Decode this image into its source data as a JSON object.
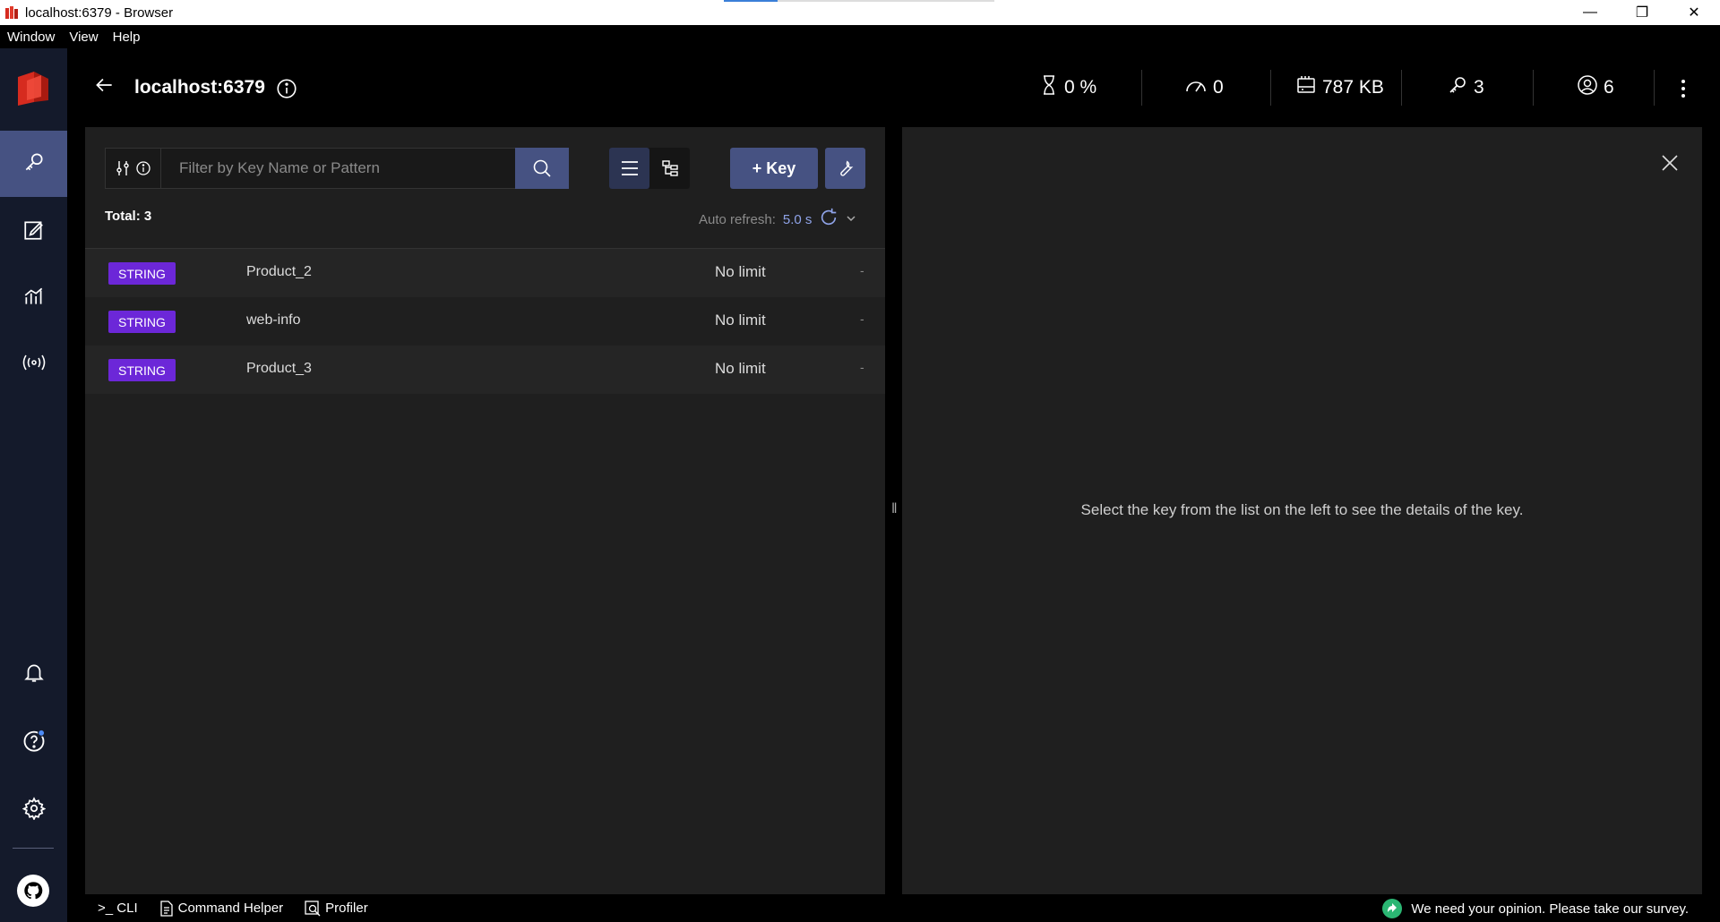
{
  "window": {
    "title": "localhost:6379 - Browser",
    "loading_progress": 0.2,
    "controls": [
      "—",
      "❐",
      "✕"
    ]
  },
  "menu": [
    "Window",
    "View",
    "Help"
  ],
  "header": {
    "host": "localhost:6379",
    "stats": {
      "cpu": "0 %",
      "ops": "0",
      "memory": "787 KB",
      "keys": "3",
      "clients": "6"
    }
  },
  "browser": {
    "search": {
      "placeholder": "Filter by Key Name or Pattern",
      "value": ""
    },
    "add_key_label": "+ Key",
    "total_label": "Total: 3",
    "auto_refresh_label": "Auto refresh:",
    "auto_refresh_value": "5.0 s",
    "keys": [
      {
        "type": "STRING",
        "name": "Product_2",
        "ttl": "No limit",
        "size": "-"
      },
      {
        "type": "STRING",
        "name": "web-info",
        "ttl": "No limit",
        "size": "-"
      },
      {
        "type": "STRING",
        "name": "Product_3",
        "ttl": "No limit",
        "size": "-"
      }
    ]
  },
  "details": {
    "empty_message": "Select the key from the list on the left to see the details of the key."
  },
  "bottom_bar": {
    "cli": ">_ CLI",
    "command_helper": "Command Helper",
    "profiler": "Profiler",
    "survey": "We need your opinion. Please take our survey."
  },
  "colors": {
    "accent": "#465282",
    "string_badge": "#6c27d8",
    "sidebar": "#141a2b"
  }
}
